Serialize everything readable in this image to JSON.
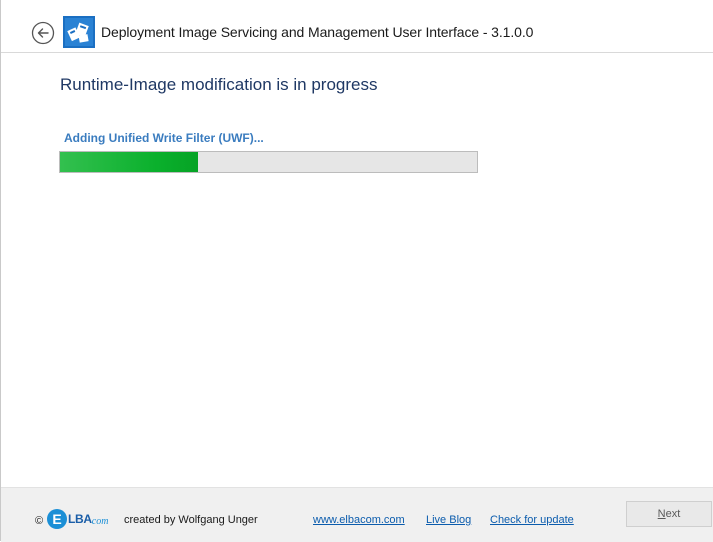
{
  "window": {
    "title": "Deployment Image Servicing and Management User Interface - 3.1.0.0"
  },
  "icons": {
    "back": "back-arrow-icon",
    "app": "app-logo-icon"
  },
  "page": {
    "heading": "Runtime-Image modification is in progress"
  },
  "progress": {
    "status_text": "Adding Unified Write Filter (UWF)...",
    "fraction": 0.33
  },
  "footer": {
    "copyright_symbol": "©",
    "logo": {
      "badge": "E",
      "text": "LBA",
      "suffix": "com"
    },
    "credit": "created by Wolfgang Unger",
    "links": {
      "website": "www.elbacom.com",
      "blog": "Live Blog",
      "update": "Check for update"
    },
    "next_label_mnemonic": "N",
    "next_label_rest": "ext"
  },
  "colors": {
    "heading": "#1f3864",
    "status": "#3a7cbf",
    "progress_fill": "#0ab02c",
    "link": "#0b5cad"
  }
}
